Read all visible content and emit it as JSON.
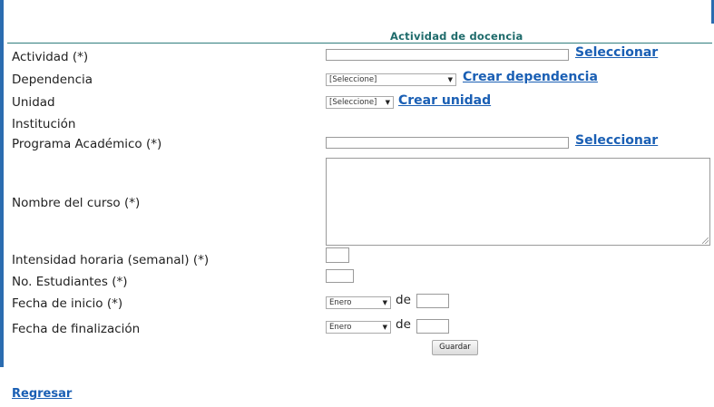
{
  "form": {
    "title": "Actividad de docencia",
    "labels": {
      "actividad": "Actividad (*)",
      "dependencia": "Dependencia",
      "unidad": "Unidad",
      "institucion": "Institución",
      "programa": "Programa Académico (*)",
      "nombre_curso": "Nombre del curso (*)",
      "intensidad": "Intensidad horaria (semanal) (*)",
      "estudiantes": "No. Estudiantes (*)",
      "fecha_inicio": "Fecha de inicio (*)",
      "fecha_fin": "Fecha de finalización"
    },
    "links": {
      "seleccionar": "Seleccionar",
      "crear_dependencia": "Crear dependencia",
      "crear_unidad": "Crear unidad"
    },
    "selects": {
      "dependencia": "[Seleccione]",
      "unidad": "[Seleccione]",
      "mes_inicio": "Enero",
      "mes_fin": "Enero"
    },
    "de_label": "de",
    "save_label": "Guardar",
    "back_label": "Regresar"
  }
}
